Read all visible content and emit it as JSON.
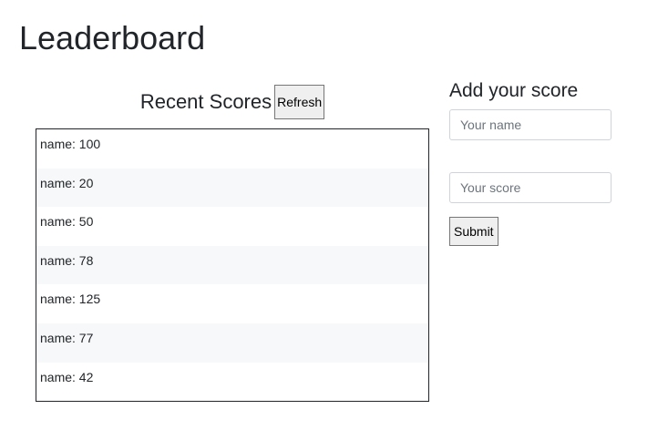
{
  "page": {
    "title": "Leaderboard"
  },
  "scores": {
    "heading": "Recent Scores",
    "refresh_label": "Refresh",
    "rows": [
      "name: 100",
      "name: 20",
      "name: 50",
      "name: 78",
      "name: 125",
      "name: 77",
      "name: 42"
    ]
  },
  "form": {
    "heading": "Add your score",
    "name_placeholder": "Your name",
    "name_value": "",
    "score_placeholder": "Your score",
    "score_value": "",
    "submit_label": "Submit"
  },
  "colors": {
    "text": "#212529",
    "stripe": "#f7f8f9",
    "input_border": "#ced4da",
    "button_bg": "#efefef"
  }
}
